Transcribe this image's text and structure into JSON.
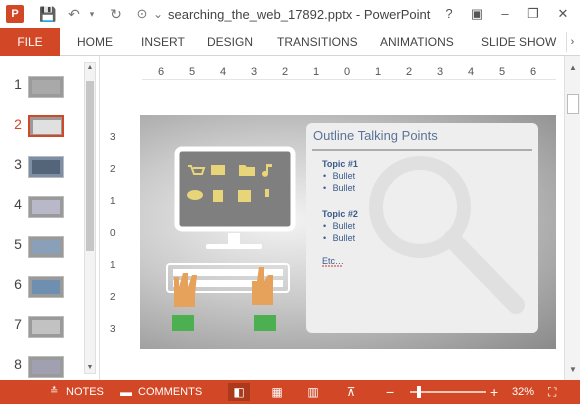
{
  "window": {
    "title": "searching_the_web_17892.pptx - PowerPoint",
    "app_icon_label": "P",
    "help_icon": "?",
    "minimize_icon": "–",
    "restore_icon": "❐",
    "close_icon": "✕"
  },
  "quick_access": {
    "save_icon": "💾",
    "undo_icon": "↶",
    "redo_icon": "↻",
    "customize_icon": "⌄"
  },
  "ribbon": {
    "file_label": "FILE",
    "tabs": [
      "HOME",
      "INSERT",
      "DESIGN",
      "TRANSITIONS",
      "ANIMATIONS",
      "SLIDE SHOW"
    ],
    "more_icon": "›"
  },
  "thumbnails": {
    "numbers": [
      "1",
      "2",
      "3",
      "4",
      "5",
      "6",
      "7",
      "8"
    ],
    "active_index": 2
  },
  "ruler": {
    "horizontal": [
      "6",
      "5",
      "4",
      "3",
      "2",
      "1",
      "0",
      "1",
      "2",
      "3",
      "4",
      "5",
      "6"
    ],
    "vertical": [
      "3",
      "2",
      "1",
      "0",
      "1",
      "2",
      "3"
    ]
  },
  "slide": {
    "panel_title": "Outline Talking Points",
    "topic1": "Topic #1",
    "topic1_bullets": [
      "Bullet",
      "Bullet"
    ],
    "topic2": "Topic #2",
    "topic2_bullets": [
      "Bullet",
      "Bullet"
    ],
    "etc": "Etc…"
  },
  "statusbar": {
    "notes_label": "NOTES",
    "comments_label": "COMMENTS",
    "zoom_percent": "32%",
    "zoom_level": 0.32,
    "zoom_minus": "−",
    "zoom_plus": "+"
  },
  "colors": {
    "accent": "#d24726",
    "icon_yellow": "#e8d57a",
    "sleeve_green": "#4caf50",
    "skin": "#e6a15a"
  }
}
